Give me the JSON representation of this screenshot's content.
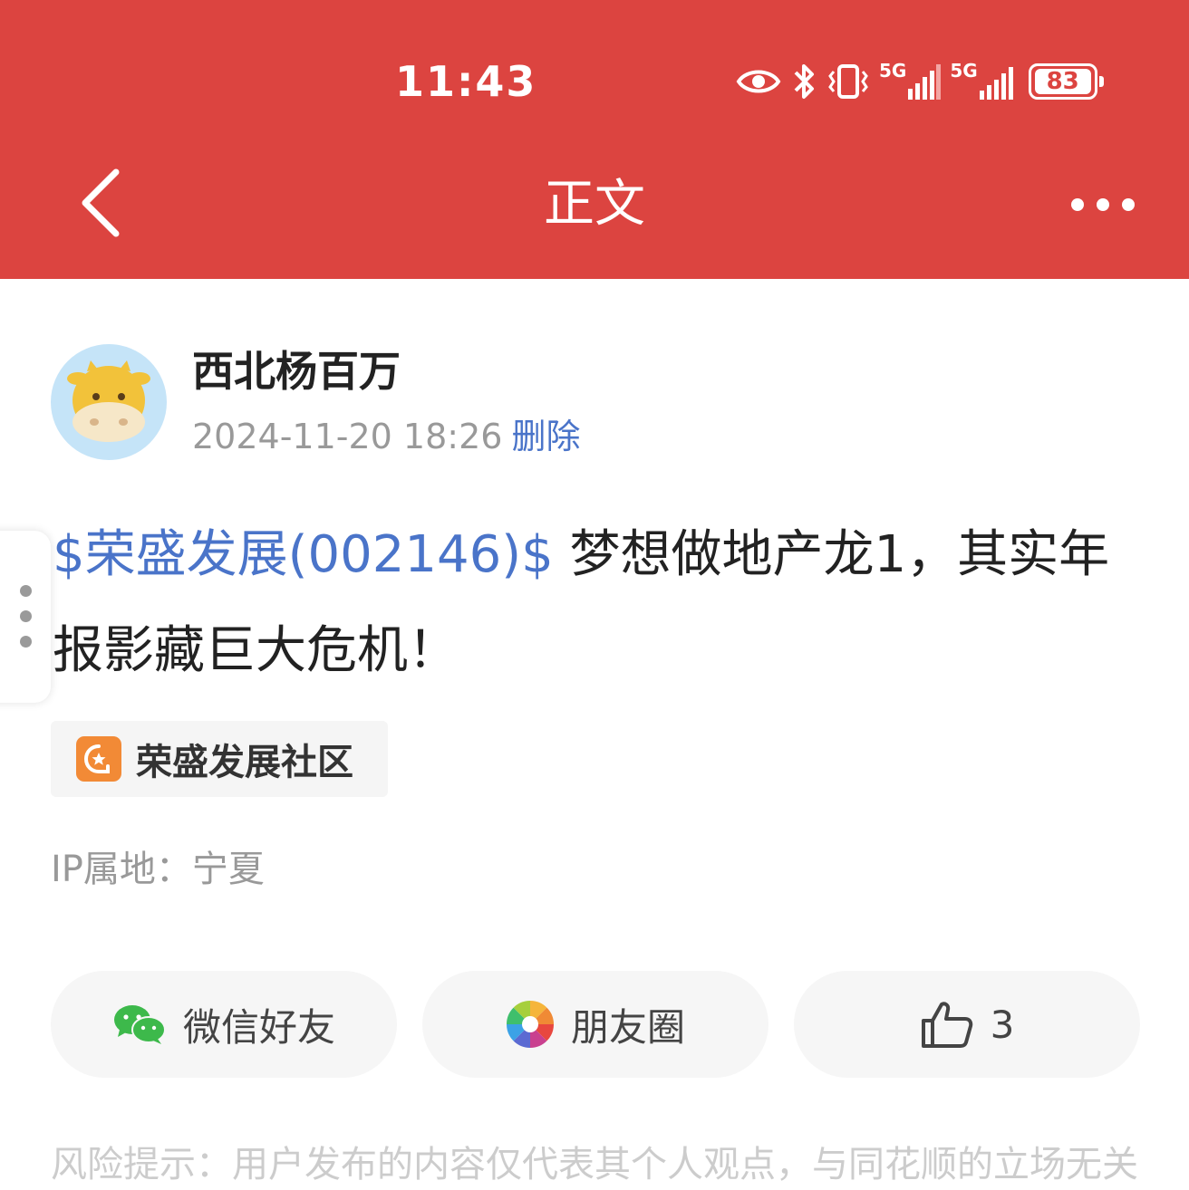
{
  "status_bar": {
    "time": "11:43",
    "network1": "5G",
    "network2": "5G",
    "battery": "83"
  },
  "nav": {
    "title": "正文"
  },
  "author": {
    "name": "西北杨百万",
    "time": "2024-11-20 18:26",
    "delete_label": "删除"
  },
  "post": {
    "stock_tag": "$荣盛发展(002146)$",
    "text": " 梦想做地产龙1，其实年报影藏巨大危机！"
  },
  "community": {
    "label": "荣盛发展社区"
  },
  "ip_location": "IP属地：宁夏",
  "actions": {
    "wechat_label": "微信好友",
    "moments_label": "朋友圈",
    "like_count": "3"
  },
  "footer": {
    "risk_tip": "风险提示：用户发布的内容仅代表其个人观点，与同花顺的立场无关"
  },
  "colors": {
    "header_bg": "#dc4440",
    "link_blue": "#4a74c9",
    "community_icon": "#f28a36",
    "wechat_green": "#3db94b"
  }
}
